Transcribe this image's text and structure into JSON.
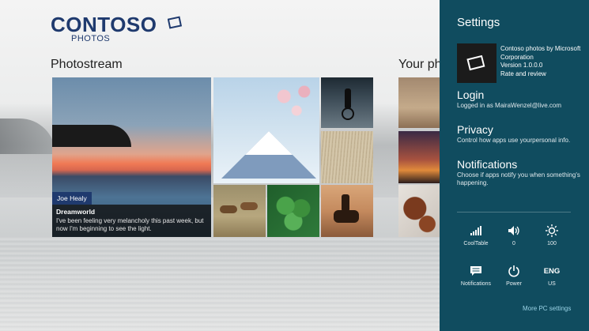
{
  "logo": {
    "word": "CONTOSO",
    "sub": "PHOTOS"
  },
  "sections": {
    "photostream": "Photostream",
    "your_photos": "Your pho"
  },
  "feature": {
    "author": "Joe Healy",
    "title": "Dreamworld",
    "text": "I've been feeling very melancholy this past week, but now I'm beginning to see the light."
  },
  "settings": {
    "title": "Settings",
    "app_info": [
      "Contoso photos by Microsoft",
      "Corporation",
      "Version 1.0.0.0",
      "Rate and review"
    ],
    "links": [
      {
        "heading": "Login",
        "desc": "Logged in as MairaWenzel@live.com"
      },
      {
        "heading": "Privacy",
        "desc": "Control how apps use yourpersonal info."
      },
      {
        "heading": "Notifications",
        "desc": "Choose if apps notify you when something's happening."
      }
    ],
    "system": [
      {
        "icon": "signal-icon",
        "label": "CoolTable"
      },
      {
        "icon": "volume-icon",
        "label": "0"
      },
      {
        "icon": "brightness-icon",
        "label": "100"
      },
      {
        "icon": "notifications-icon",
        "label": "Notifications"
      },
      {
        "icon": "power-icon",
        "label": "Power"
      },
      {
        "icon": "keyboard-icon",
        "value": "ENG",
        "label": "US"
      }
    ],
    "more": "More PC settings"
  },
  "colors": {
    "charm_bg": "#104c5f",
    "brand": "#1f3a6e",
    "link": "#9ad3e6"
  }
}
